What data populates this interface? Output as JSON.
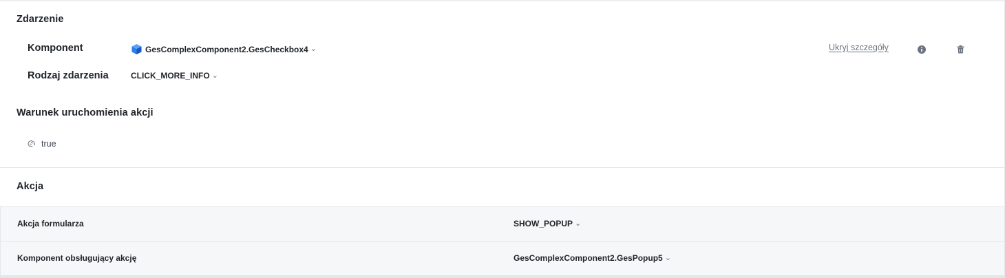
{
  "event_section": {
    "title": "Zdarzenie",
    "component": {
      "label": "Komponent",
      "value": "GesComplexComponent2.GesCheckbox4",
      "icon": "cube-icon"
    },
    "event_type": {
      "label": "Rodzaj zdarzenia",
      "value": "CLICK_MORE_INFO"
    },
    "hide_details_link": "Ukryj szczegóły",
    "info_icon": "info-icon",
    "delete_icon": "trash-icon"
  },
  "condition_section": {
    "title": "Warunek uruchomienia akcji",
    "value": "true",
    "icon": "brain-icon"
  },
  "action_section": {
    "title": "Akcja",
    "rows": [
      {
        "label": "Akcja formularza",
        "value": "SHOW_POPUP"
      },
      {
        "label": "Komponent obsługujący akcję",
        "value": "GesComplexComponent2.GesPopup5"
      }
    ]
  },
  "colors": {
    "accent_blue": "#1e6fe0",
    "muted_text": "#6b7280",
    "row_bg": "#f6f7f8",
    "border": "#e4e6ea"
  }
}
